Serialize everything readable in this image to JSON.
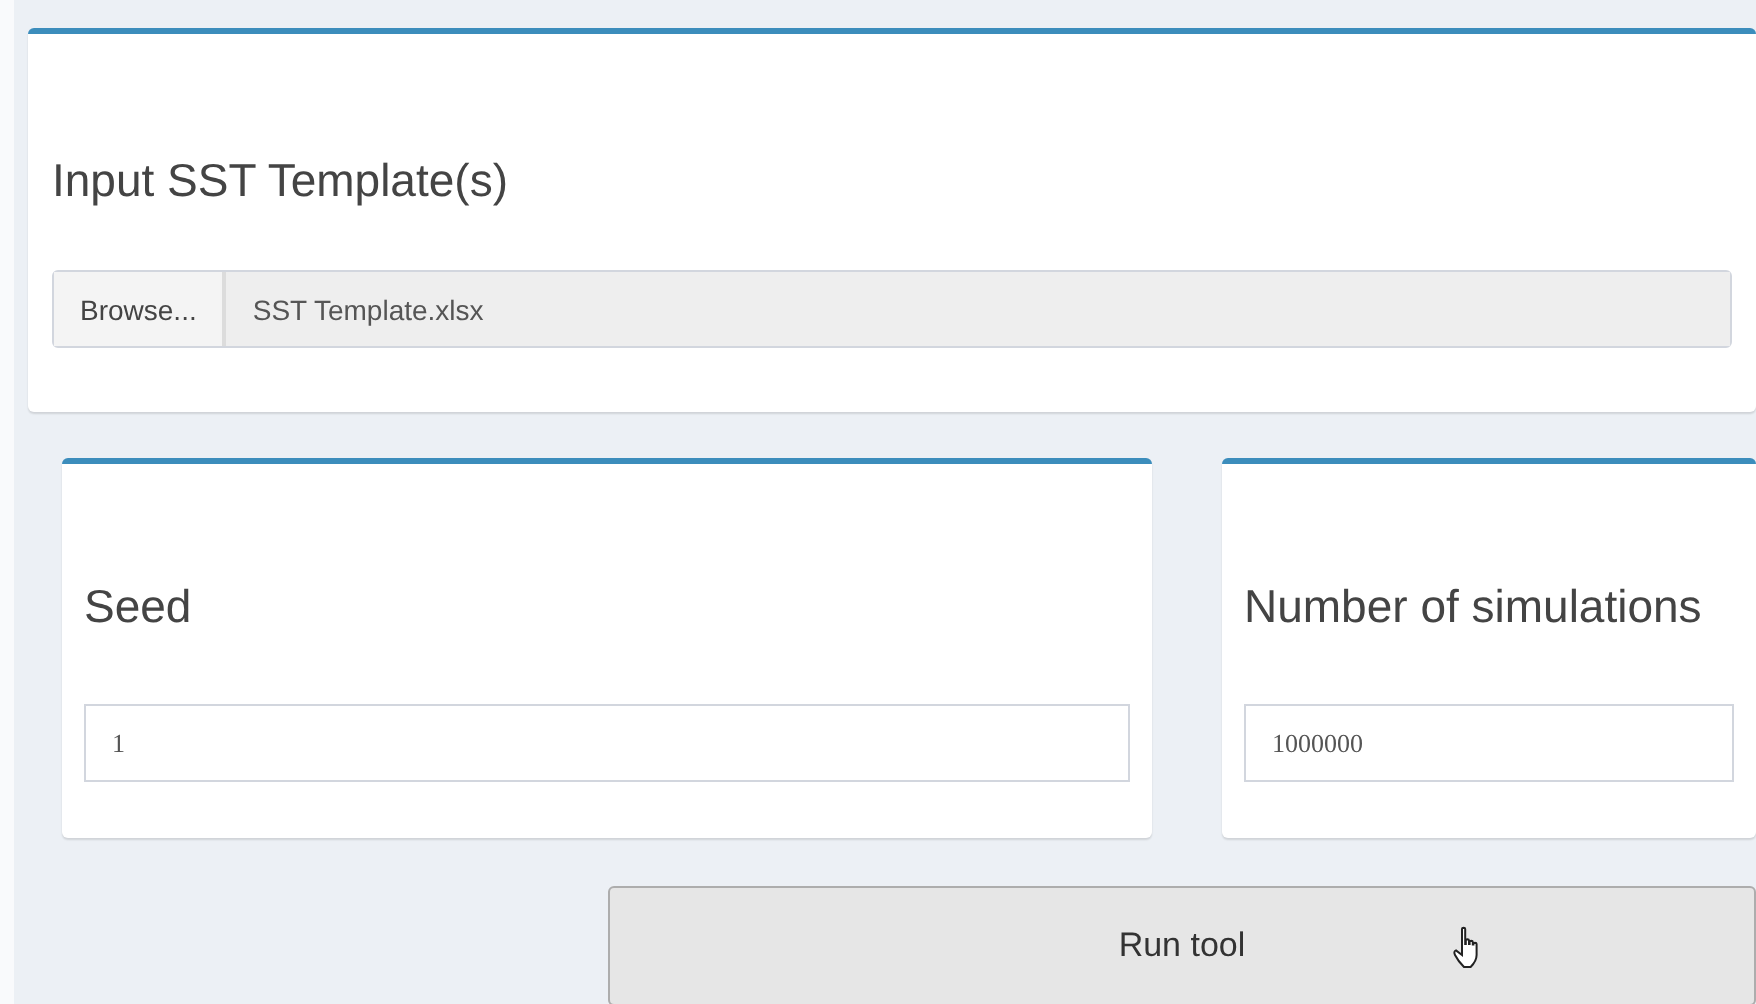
{
  "upload_box": {
    "title": "Input SST Template(s)",
    "browse_button": "Browse...",
    "file_name": "SST Template.xlsx"
  },
  "settings": [
    {
      "title": "Seed",
      "value": "1"
    },
    {
      "title": "Number of simulations",
      "value": "1000000"
    }
  ],
  "run_button": {
    "label": "Run tool"
  }
}
